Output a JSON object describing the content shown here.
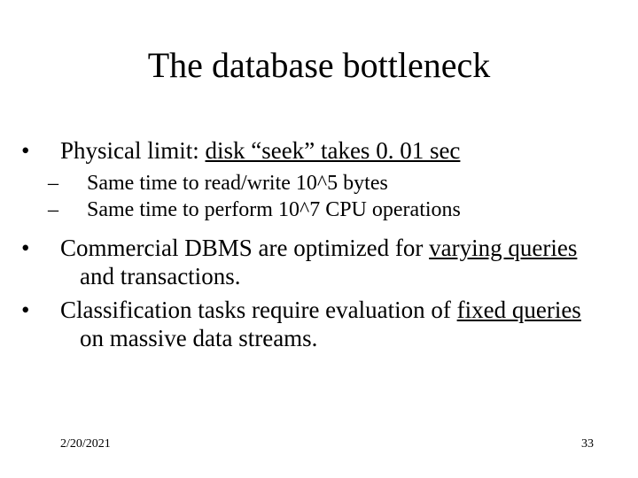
{
  "title": "The database bottleneck",
  "bullets": {
    "b1": {
      "pre": "Physical limit: ",
      "u": "disk “seek” takes 0. 01 sec"
    },
    "s1": "Same time to read/write 10^5 bytes",
    "s2": "Same time to perform 10^7 CPU operations",
    "b2": {
      "pre": "Commercial DBMS are optimized for ",
      "u": "varying queries",
      "post": " and transactions."
    },
    "b3": {
      "pre": "Classification tasks require evaluation of ",
      "u": "fixed queries",
      "post": " on massive data streams."
    }
  },
  "footer": {
    "date": "2/20/2021",
    "page": "33"
  }
}
